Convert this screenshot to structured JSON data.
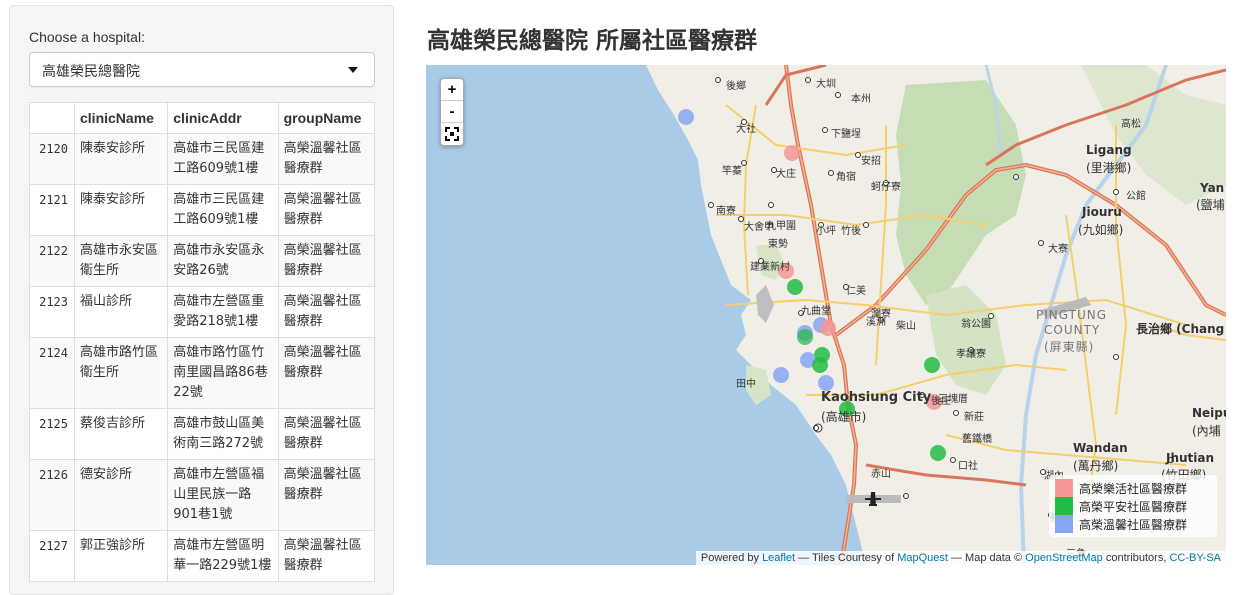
{
  "sidebar": {
    "select_label": "Choose a hospital:",
    "selected_hospital": "高雄榮民總醫院",
    "columns": [
      "",
      "clinicName",
      "clinicAddr",
      "groupName"
    ],
    "rows": [
      {
        "id": "2120",
        "name": "陳泰安診所",
        "addr": "高雄市三民區建工路609號1樓",
        "group": "高榮溫馨社區醫療群"
      },
      {
        "id": "2121",
        "name": "陳泰安診所",
        "addr": "高雄市三民區建工路609號1樓",
        "group": "高榮溫馨社區醫療群"
      },
      {
        "id": "2122",
        "name": "高雄市永安區衛生所",
        "addr": "高雄市永安區永安路26號",
        "group": "高榮溫馨社區醫療群"
      },
      {
        "id": "2123",
        "name": "福山診所",
        "addr": "高雄市左營區重愛路218號1樓",
        "group": "高榮溫馨社區醫療群"
      },
      {
        "id": "2124",
        "name": "高雄市路竹區衛生所",
        "addr": "高雄市路竹區竹南里國昌路86巷22號",
        "group": "高榮溫馨社區醫療群"
      },
      {
        "id": "2125",
        "name": "蔡俊吉診所",
        "addr": "高雄市鼓山區美術南三路272號",
        "group": "高榮溫馨社區醫療群"
      },
      {
        "id": "2126",
        "name": "德安診所",
        "addr": "高雄市左營區福山里民族一路901巷1號",
        "group": "高榮溫馨社區醫療群"
      },
      {
        "id": "2127",
        "name": "郭正強診所",
        "addr": "高雄市左營區明華一路229號1樓",
        "group": "高榮溫馨社區醫療群"
      }
    ]
  },
  "main": {
    "title": "高雄榮民總醫院 所屬社區醫療群"
  },
  "map": {
    "zoom_in": "+",
    "zoom_out": "-",
    "fullscreen_icon": "fullscreen-icon",
    "legend": [
      {
        "label": "高榮樂活社區醫療群",
        "color": "#f59794"
      },
      {
        "label": "高榮平安社區醫療群",
        "color": "#22bb44"
      },
      {
        "label": "高榮溫馨社區醫療群",
        "color": "#86a6f3"
      }
    ],
    "labels": {
      "kaohsiung_en": "Kaohsiung City",
      "kaohsiung_zh": "(高雄市)",
      "pingtung_en1": "PINGTUNG",
      "pingtung_en2": "COUNTY",
      "pingtung_zh": "(屏東縣)",
      "ligang_en": "Ligang",
      "ligang_zh": "(里港鄉)",
      "jiouru_en": "Jiouru",
      "jiouru_zh": "(九如鄉)",
      "changzhi": "長治鄉 (Chang",
      "wandan_en": "Wandan",
      "wandan_zh": "(萬丹鄉)",
      "jhutian_en": "Jhutian",
      "jhutian_zh": "(竹田鄉)",
      "neipu_en": "Neipu",
      "neipu_zh": "(內埔",
      "yan_en": "Yan",
      "yan_zh": "(鹽埔"
    },
    "towns": [
      "後鄉",
      "大圳",
      "本州",
      "大社",
      "下鹽埕",
      "安招",
      "竿蓁",
      "大庄",
      "角宿",
      "南寮",
      "大舍甲",
      "九甲圍",
      "蚵仔寮",
      "竹後",
      "建業新村",
      "東勢",
      "小坪",
      "仁美",
      "九曲堂",
      "柴山",
      "後庄",
      "新莊",
      "孝讓寮",
      "翁公園",
      "田中",
      "三塊厝",
      "舊鐵橋",
      "口社",
      "湖內",
      "新園",
      "赤山",
      "高松",
      "大寮",
      "公館",
      "溪洲",
      "瀾寮",
      "三角"
    ],
    "attribution": {
      "prefix": "Powered by ",
      "leaflet": "Leaflet",
      "tiles": " — Tiles Courtesy of ",
      "mapquest": "MapQuest",
      "mapdata": " — Map data © ",
      "osm": "OpenStreetMap",
      "contrib": " contributors, ",
      "license": "CC-BY-SA"
    }
  }
}
